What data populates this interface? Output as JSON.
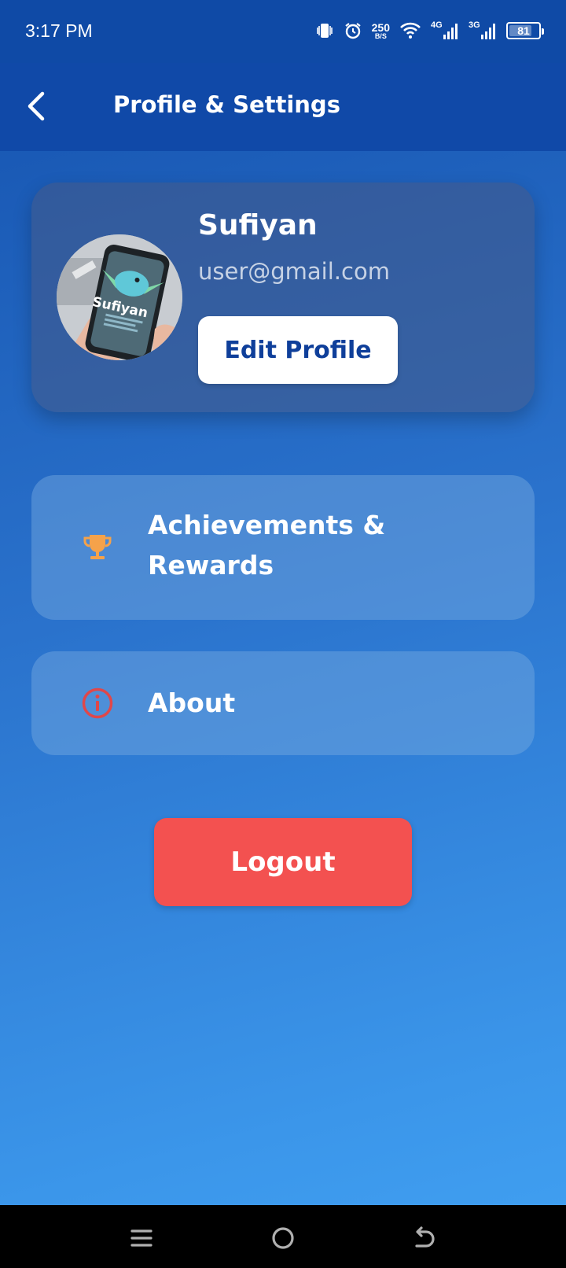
{
  "status_bar": {
    "time": "3:17 PM",
    "speed_value": "250",
    "speed_unit": "B/S",
    "network1": "4G",
    "network2": "3G",
    "battery": "81",
    "battery_level": 0.81
  },
  "header": {
    "title": "Profile & Settings",
    "back_icon": "chevron-left-icon"
  },
  "profile": {
    "name": "Sufiyan",
    "email": "user@gmail.com",
    "edit_label": "Edit Profile",
    "avatar_text": "Sufiyan"
  },
  "menu": {
    "items": [
      {
        "label": "Achievements & Rewards",
        "icon": "trophy-icon",
        "icon_color": "#f5a24a"
      },
      {
        "label": "About",
        "icon": "info-icon",
        "icon_color": "#e0474a"
      }
    ]
  },
  "logout": {
    "label": "Logout",
    "color": "#f35150"
  },
  "nav": {
    "icons": [
      "menu-icon",
      "home-icon",
      "back-icon"
    ]
  },
  "colors": {
    "header_bg": "#1049a8",
    "accent_text": "#0f3f9a"
  }
}
